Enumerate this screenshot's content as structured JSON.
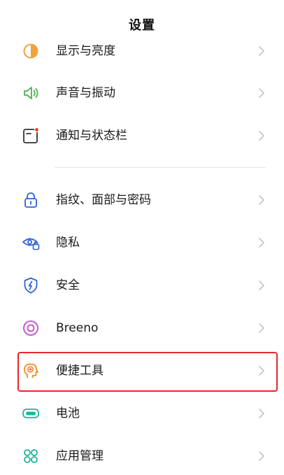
{
  "header": {
    "title": "设置"
  },
  "settings": {
    "items": [
      {
        "label": "显示与亮度",
        "icon": "display-brightness-icon"
      },
      {
        "label": "声音与振动",
        "icon": "speaker-icon"
      },
      {
        "label": "通知与状态栏",
        "icon": "notification-icon"
      },
      {
        "label": "指纹、面部与密码",
        "icon": "lock-icon"
      },
      {
        "label": "隐私",
        "icon": "privacy-eye-icon"
      },
      {
        "label": "安全",
        "icon": "security-shield-icon"
      },
      {
        "label": "Breeno",
        "icon": "breeno-icon"
      },
      {
        "label": "便捷工具",
        "icon": "convenience-tools-icon"
      },
      {
        "label": "电池",
        "icon": "battery-icon"
      },
      {
        "label": "应用管理",
        "icon": "app-management-icon"
      }
    ]
  },
  "colors": {
    "display_icon": "#f0a33a",
    "sound_icon": "#4caf50",
    "notification_dot": "#e53935",
    "lock_icon": "#2f63d6",
    "privacy_icon": "#2f63d6",
    "security_icon": "#2f63d6",
    "breeno_icon": "#c44ad4",
    "tools_icon": "#f08a24",
    "battery_icon": "#21b29a",
    "apps_icon": "#21b29a",
    "highlight": "#e8262a"
  }
}
